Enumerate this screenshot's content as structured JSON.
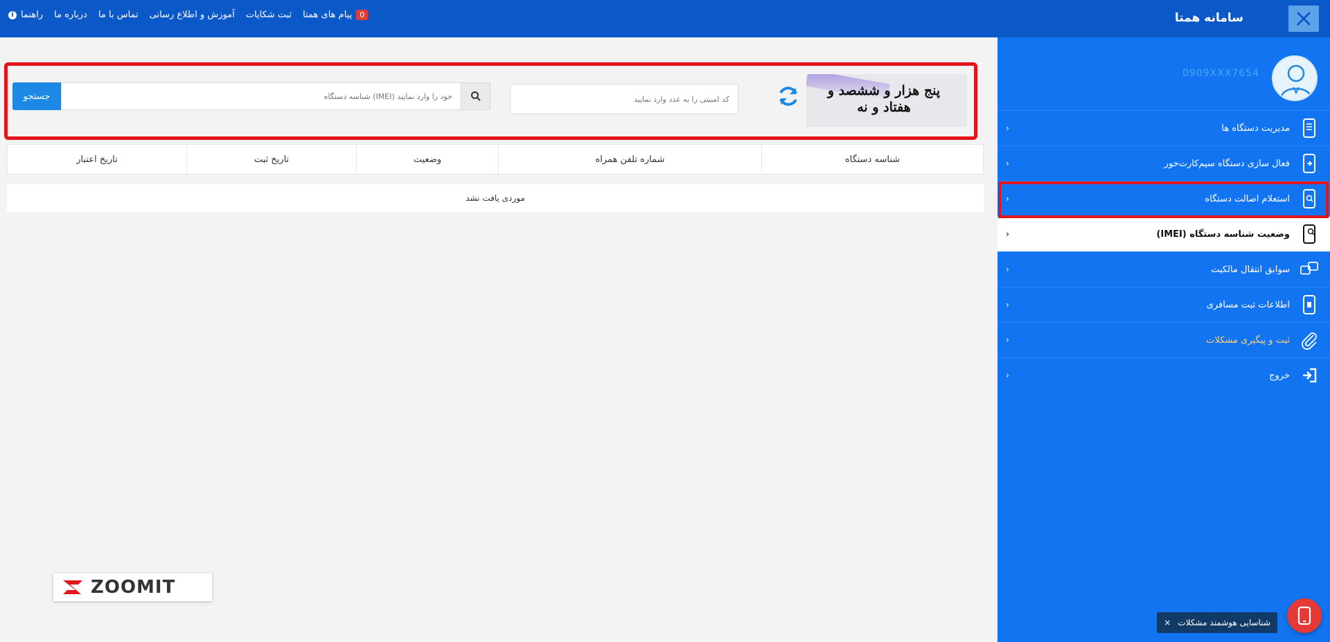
{
  "header": {
    "app_title": "سامانه همتا",
    "nav": [
      {
        "label": "راهنما"
      },
      {
        "label": "درباره ما"
      },
      {
        "label": "تماس با ما"
      },
      {
        "label": "آموزش و اطلاع رسانی"
      },
      {
        "label": "ثبت شکایات"
      },
      {
        "label": "پیام های همتا",
        "badge": "0"
      }
    ]
  },
  "sidebar": {
    "user_phone": "0909XXX7654",
    "items": [
      {
        "label": "مدیریت دستگاه ها"
      },
      {
        "label": "فعال سازی دستگاه سیم‌کارت‌خور"
      },
      {
        "label": "استعلام اصالت دستگاه"
      },
      {
        "label": "وضعیت شناسه دستگاه (IMEI)"
      },
      {
        "label": "سوابق انتقال مالکیت"
      },
      {
        "label": "اطلاعات ثبت مسافری"
      },
      {
        "label": "ثبت و پیگیری مشکلات"
      },
      {
        "label": "خروج"
      }
    ]
  },
  "search": {
    "captcha_text": "پنج هزار و ششصد و هفتاد و نه",
    "captcha_placeholder": "کد امنیتی را به عدد وارد نمایید",
    "imei_placeholder": "خود را وارد نمایید (IMEI) شناسه دستگاه",
    "button_label": "جستجو"
  },
  "table": {
    "columns": [
      "شناسه دستگاه",
      "شماره تلفن همراه",
      "وضعیت",
      "تاریخ ثبت",
      "تاریخ اعتبار"
    ],
    "empty_message": "موردی یافت نشد"
  },
  "watermark": {
    "text": "ZOOMIT"
  },
  "assistant": {
    "label": "شناسایی هوشمند مشکلات",
    "close": "×"
  },
  "colors": {
    "topbar": "#0b58c9",
    "sidebar": "#1274f0",
    "highlight": "#e3141c",
    "accent": "#1e88e5"
  }
}
